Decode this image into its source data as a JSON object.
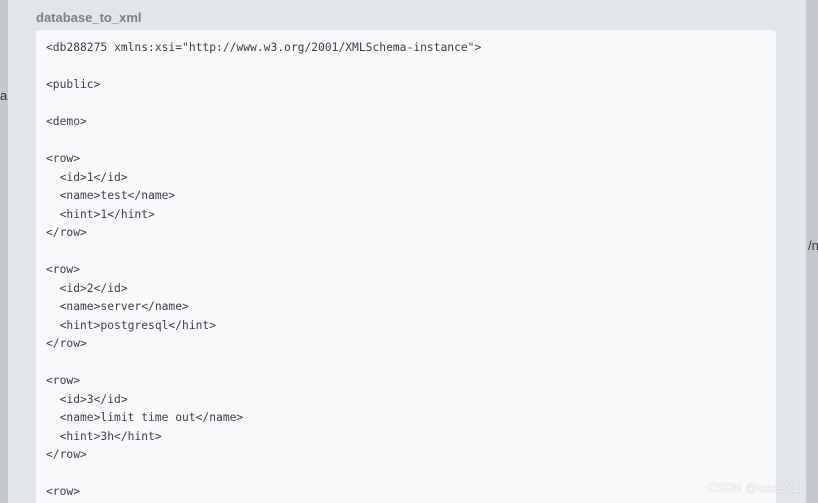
{
  "background": {
    "left_fragment": "a",
    "right_fragment": "/n"
  },
  "dialog": {
    "title": "database_to_xml",
    "code": "<db288275 xmlns:xsi=\"http://www.w3.org/2001/XMLSchema-instance\">\n\n<public>\n\n<demo>\n\n<row>\n  <id>1</id>\n  <name>test</name>\n  <hint>1</hint>\n</row>\n\n<row>\n  <id>2</id>\n  <name>server</name>\n  <hint>postgresql</hint>\n</row>\n\n<row>\n  <id>3</id>\n  <name>limit time out</name>\n  <hint>3h</hint>\n</row>\n\n<row>"
  },
  "watermark": "CSDN @tcsecXD",
  "colors": {
    "overlay": "#c5c9cf",
    "dialog_bg": "#e2e5e9",
    "code_bg": "#f7f9fb",
    "title": "#7a8087"
  }
}
